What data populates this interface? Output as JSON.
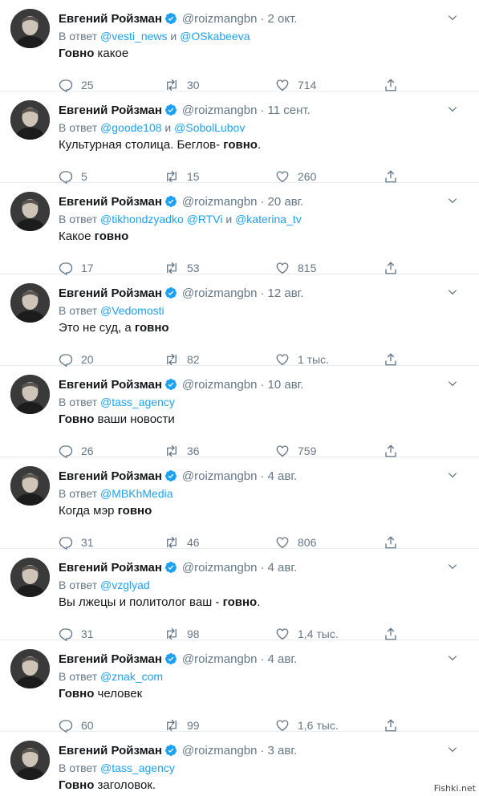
{
  "author": {
    "name": "Евгений Ройзман",
    "handle": "@roizmangbn",
    "verified": true
  },
  "reply_prefix": "В ответ",
  "tweets": [
    {
      "date": "2 окт.",
      "reply_to": [
        {
          "t": "@vesti_news",
          "m": true
        },
        {
          "t": " и ",
          "m": false
        },
        {
          "t": "@OSkabeeva",
          "m": true
        }
      ],
      "text": [
        {
          "t": "Говно",
          "b": true
        },
        {
          "t": " какое",
          "b": false
        }
      ],
      "replies": "25",
      "retweets": "30",
      "likes": "714"
    },
    {
      "date": "11 сент.",
      "reply_to": [
        {
          "t": "@goode108",
          "m": true
        },
        {
          "t": " и ",
          "m": false
        },
        {
          "t": "@SobolLubov",
          "m": true
        }
      ],
      "text": [
        {
          "t": "Культурная столица. Беглов- ",
          "b": false
        },
        {
          "t": "говно",
          "b": true
        },
        {
          "t": ".",
          "b": false
        }
      ],
      "replies": "5",
      "retweets": "15",
      "likes": "260"
    },
    {
      "date": "20 авг.",
      "reply_to": [
        {
          "t": "@tikhondzyadko",
          "m": true
        },
        {
          "t": " ",
          "m": false
        },
        {
          "t": "@RTVi",
          "m": true
        },
        {
          "t": " и ",
          "m": false
        },
        {
          "t": "@katerina_tv",
          "m": true
        }
      ],
      "text": [
        {
          "t": "Какое ",
          "b": false
        },
        {
          "t": "говно",
          "b": true
        }
      ],
      "replies": "17",
      "retweets": "53",
      "likes": "815"
    },
    {
      "date": "12 авг.",
      "reply_to": [
        {
          "t": "@Vedomosti",
          "m": true
        }
      ],
      "text": [
        {
          "t": "Это не суд, а ",
          "b": false
        },
        {
          "t": "говно",
          "b": true
        }
      ],
      "replies": "20",
      "retweets": "82",
      "likes": "1 тыс."
    },
    {
      "date": "10 авг.",
      "reply_to": [
        {
          "t": "@tass_agency",
          "m": true
        }
      ],
      "text": [
        {
          "t": "Говно",
          "b": true
        },
        {
          "t": " ваши новости",
          "b": false
        }
      ],
      "replies": "26",
      "retweets": "36",
      "likes": "759"
    },
    {
      "date": "4 авг.",
      "reply_to": [
        {
          "t": "@MBKhMedia",
          "m": true
        }
      ],
      "text": [
        {
          "t": "Когда мэр ",
          "b": false
        },
        {
          "t": "говно",
          "b": true
        }
      ],
      "replies": "31",
      "retweets": "46",
      "likes": "806"
    },
    {
      "date": "4 авг.",
      "reply_to": [
        {
          "t": "@vzglyad",
          "m": true
        }
      ],
      "text": [
        {
          "t": "Вы лжецы и политолог ваш - ",
          "b": false
        },
        {
          "t": "говно",
          "b": true
        },
        {
          "t": ".",
          "b": false
        }
      ],
      "replies": "31",
      "retweets": "98",
      "likes": "1,4 тыс."
    },
    {
      "date": "4 авг.",
      "reply_to": [
        {
          "t": "@znak_com",
          "m": true
        }
      ],
      "text": [
        {
          "t": "Говно",
          "b": true
        },
        {
          "t": " человек",
          "b": false
        }
      ],
      "replies": "60",
      "retweets": "99",
      "likes": "1,6 тыс."
    },
    {
      "date": "3 авг.",
      "reply_to": [
        {
          "t": "@tass_agency",
          "m": true
        }
      ],
      "text": [
        {
          "t": "Говно",
          "b": true
        },
        {
          "t": " заголовок.",
          "b": false
        }
      ],
      "replies": "",
      "retweets": "",
      "likes": ""
    }
  ],
  "watermark": "Fishki.net",
  "colors": {
    "accent": "#1da1f2",
    "muted": "#657786",
    "text": "#14171a",
    "divider": "#e6ecf0"
  }
}
